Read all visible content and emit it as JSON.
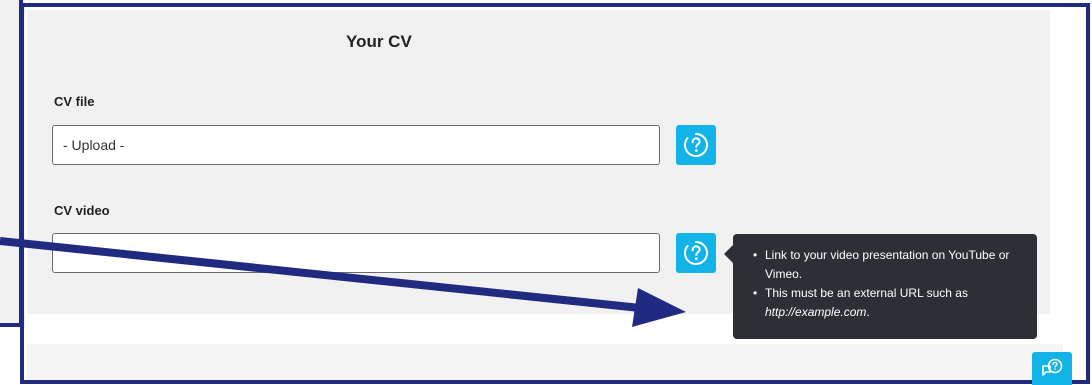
{
  "section": {
    "title": "Your CV"
  },
  "fields": {
    "cv_file": {
      "label": "CV file",
      "value": "- Upload -"
    },
    "cv_video": {
      "label": "CV video",
      "value": ""
    }
  },
  "tooltip": {
    "item1": "Link to your video presentation on YouTube or Vimeo.",
    "item2_prefix": "This must be an external URL such as",
    "item2_url": "http://example.com",
    "item2_suffix": "."
  },
  "icons": {
    "help": "help-circle-icon",
    "chat_help": "chat-help-icon"
  },
  "colors": {
    "accent": "#12b3e6",
    "highlight_frame": "#1f2a80",
    "tooltip_bg": "#2c2f33",
    "panel_bg": "#f1f1f1"
  }
}
